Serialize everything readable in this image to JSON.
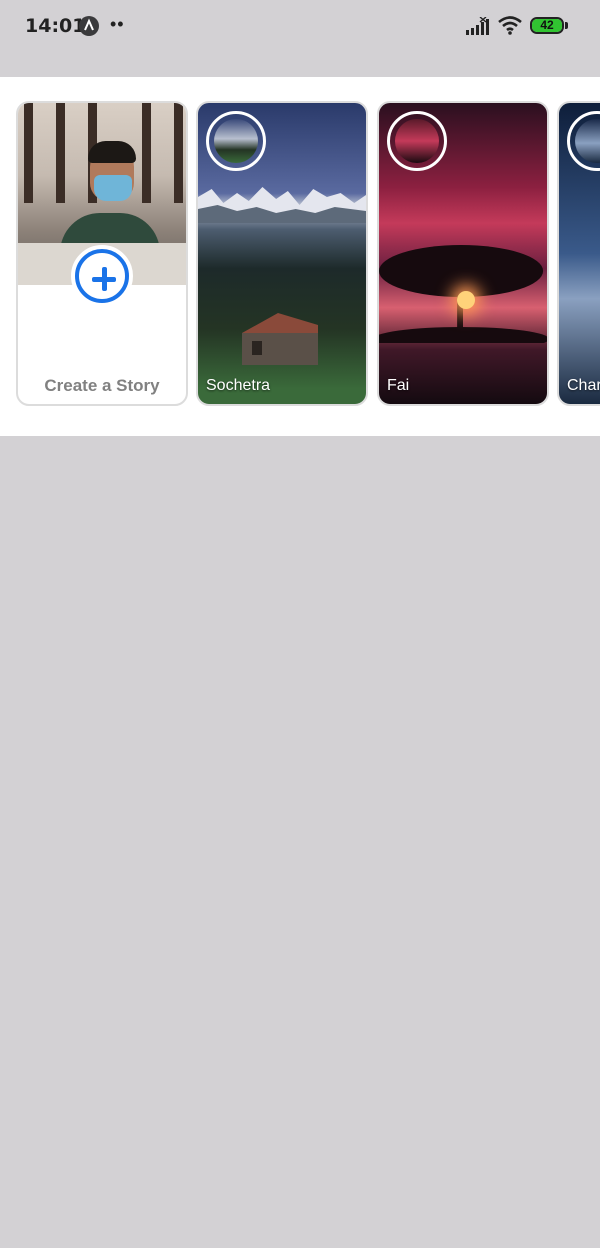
{
  "status_bar": {
    "time": "14:01",
    "notification_dots": "••",
    "battery_level": "42",
    "icons": [
      "app-notification-icon",
      "signal-icon",
      "wifi-icon",
      "battery-icon"
    ],
    "battery_color": "#31c431"
  },
  "stories": {
    "create_card": {
      "label": "Create a Story",
      "icon": "plus-circle-icon",
      "accent": "#1a73e8"
    },
    "items": [
      {
        "name": "Sochetra"
      },
      {
        "name": "Fai"
      },
      {
        "name": "Char"
      }
    ]
  },
  "colors": {
    "background": "#d3d1d4",
    "panel": "#ffffff",
    "create_label": "#818181"
  }
}
